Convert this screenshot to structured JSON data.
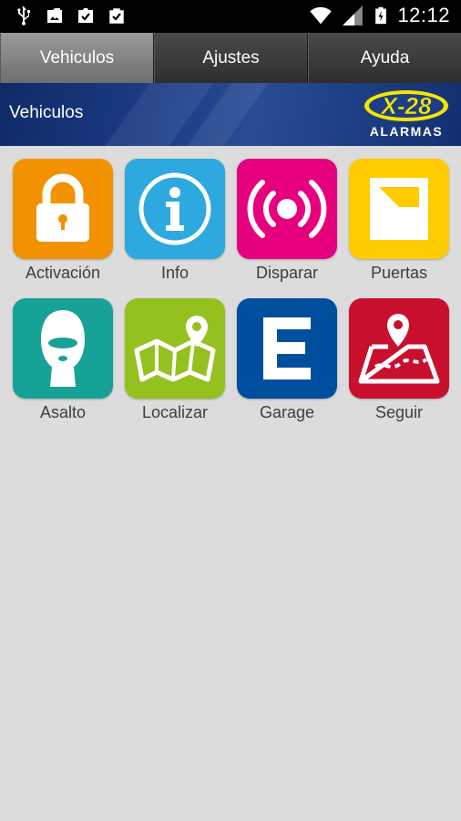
{
  "status_bar": {
    "time": "12:12",
    "icons": [
      "usb-icon",
      "image-notification-icon",
      "checked-clipboard-icon",
      "checked-bag-icon",
      "wifi-icon",
      "signal-icon",
      "battery-charging-icon"
    ]
  },
  "tabs": [
    {
      "label": "Vehiculos",
      "active": true
    },
    {
      "label": "Ajustes",
      "active": false
    },
    {
      "label": "Ayuda",
      "active": false
    }
  ],
  "header": {
    "title": "Vehiculos",
    "logo_text": "X-28",
    "logo_sub": "ALARMAS"
  },
  "tiles": [
    {
      "label": "Activación",
      "icon": "lock-icon",
      "color": "#f29200"
    },
    {
      "label": "Info",
      "icon": "info-icon",
      "color": "#2ea9e0"
    },
    {
      "label": "Disparar",
      "icon": "broadcast-icon",
      "color": "#e6007e"
    },
    {
      "label": "Puertas",
      "icon": "door-icon",
      "color": "#ffcc00"
    },
    {
      "label": "Asalto",
      "icon": "balaclava-icon",
      "color": "#17a297"
    },
    {
      "label": "Localizar",
      "icon": "map-pin-icon",
      "color": "#95c11f"
    },
    {
      "label": "Garage",
      "icon": "parking-e-icon",
      "color": "#004f9f"
    },
    {
      "label": "Seguir",
      "icon": "route-map-icon",
      "color": "#c8102e"
    }
  ],
  "colors": {
    "background": "#dcdcdc",
    "banner": "#1d3d86",
    "logo_yellow": "#f4e600"
  }
}
